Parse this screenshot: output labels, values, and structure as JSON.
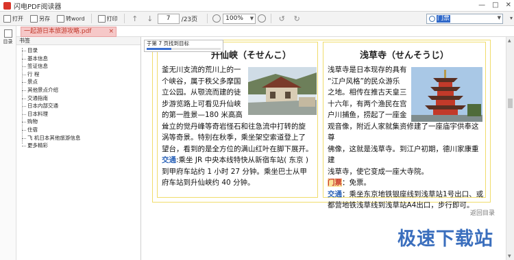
{
  "window": {
    "title": "闪电PDF阅读器",
    "controls": [
      "—",
      "□",
      "✕"
    ]
  },
  "toolbar": {
    "open_label": "打开",
    "saveas_label": "另存",
    "to_word_label": "转word",
    "print_label": "打印",
    "page_current": "7",
    "page_total": "/23页",
    "zoom_value": "100%",
    "search_value": "门票"
  },
  "tab": {
    "filename": "一起游日本旅游攻略.pdf",
    "close": "×"
  },
  "rail": {
    "toc_label": "目录"
  },
  "bookmarks": {
    "header": "书签",
    "items": [
      "目录",
      "基本信息",
      "签证信息",
      "行 程",
      "景点",
      "其他景点介绍",
      "交通指南",
      "日本内部交通",
      "日本料理",
      "购物",
      "住宿",
      "飞 机日本其他旅游信息",
      "更多精彩"
    ]
  },
  "find_popup": {
    "text": "于第 7 页找到目标",
    "progress": 0.33
  },
  "left_article": {
    "heading": "升仙峡（せんせんこ）",
    "heading_visible": "升仙峡（そせんこ）",
    "lines_top": [
      "釜无川支流的荒川上的一",
      "个峡谷，属于秩父多摩国",
      "立公园。从颚流而建的徒",
      "步游览路上可看见升仙峡",
      "的第一胜景—180 米高高"
    ],
    "lines_full": [
      "耸立的觉丹峰等奇岩怪石和往急流中打转的旋",
      "涡等奇景。特别在秋季，乘坐架空索道登上了",
      "望台，看到的是全方位的满山红叶在脚下展开。"
    ],
    "transport_label": "交通",
    "transport_lines": [
      ":乘坐 JR 中央本线特快从新宿车站( 东京 )",
      "到甲府车站约 1 小时 27 分钟。乘坐巴士从甲",
      "府车站到升仙峡约 40 分钟。"
    ]
  },
  "right_article": {
    "heading": "浅草寺（せんそうじ）",
    "lines_top": [
      "浅草寺是日本现存的具有",
      "“江户风格”的民众游乐",
      "之地。相传在推古天皇三",
      "十六年，有两个渔民在宫",
      "户川捕鱼，捞起了一座金"
    ],
    "lines_full": [
      "观音像，附近人家就集资修建了一座庙宇供奉这尊",
      "佛像，这就是浅草寺。到江户初期，德川家康重建",
      "浅草寺，使它变成一座大寺院。"
    ],
    "ticket_label": "门票",
    "ticket_text": "：免票。",
    "transport_label": "交通",
    "transport_lines": [
      "：乘坐东京地铁银座线到浅草站1号出口、或",
      "都营地铁浅草线到浅草站A4出口，步行即可。"
    ]
  },
  "back_link": "返回目录",
  "watermark": "极速下载站",
  "colors": {
    "accent_blue": "#2a62b8",
    "ticket_red": "#c9362a",
    "tab_pink": "#f6c8c8",
    "border_yellow": "#f0dc6a"
  }
}
